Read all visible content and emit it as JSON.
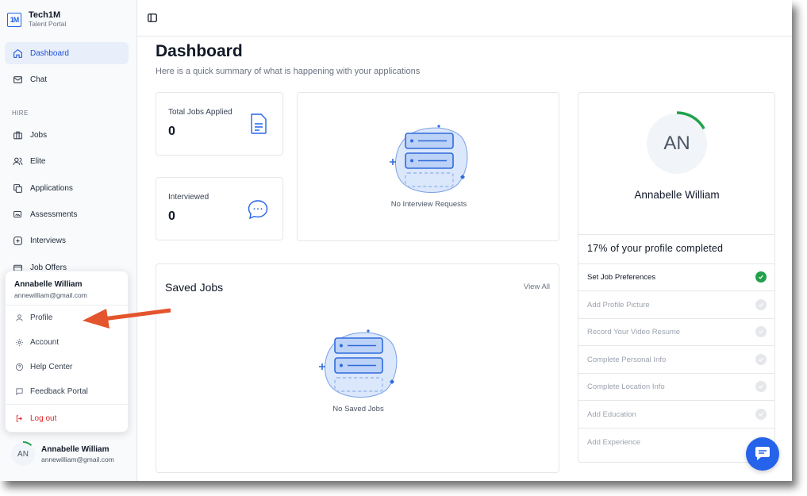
{
  "brand": {
    "name": "Tech1M",
    "subtitle": "Talent Portal",
    "logo_text": "1M"
  },
  "nav": {
    "dashboard": "Dashboard",
    "chat": "Chat",
    "section_hire": "HIRE",
    "jobs": "Jobs",
    "elite": "Elite",
    "applications": "Applications",
    "assessments": "Assessments",
    "interviews": "Interviews",
    "job_offers": "Job Offers"
  },
  "user_menu": {
    "name": "Annabelle William",
    "email": "annewilliam@gmail.com",
    "items": [
      "Profile",
      "Account",
      "Help Center",
      "Feedback Portal"
    ],
    "logout": "Log out"
  },
  "footer_user": {
    "initials": "AN",
    "name": "Annabelle William",
    "email": "annewilliam@gmail.com"
  },
  "page": {
    "title": "Dashboard",
    "subtitle": "Here is a quick summary of what is happening with your applications"
  },
  "stats": {
    "total_jobs_label": "Total Jobs Applied",
    "total_jobs_value": "0",
    "interviewed_label": "Interviewed",
    "interviewed_value": "0"
  },
  "interview_requests": {
    "empty_text": "No Interview Requests"
  },
  "saved_jobs": {
    "title": "Saved Jobs",
    "view_all": "View All",
    "empty_text": "No Saved Jobs"
  },
  "profile": {
    "initials": "AN",
    "name": "Annabelle William",
    "completion_fraction": 0.17,
    "completion_text": "17% of your profile completed",
    "tasks": [
      {
        "label": "Set Job Preferences",
        "done": true
      },
      {
        "label": "Add Profile Picture",
        "done": false
      },
      {
        "label": "Record Your Video Resume",
        "done": false
      },
      {
        "label": "Complete Personal Info",
        "done": false
      },
      {
        "label": "Complete Location Info",
        "done": false
      },
      {
        "label": "Add Education",
        "done": false
      },
      {
        "label": "Add Experience",
        "done": false
      }
    ]
  },
  "colors": {
    "accent": "#2563eb",
    "success": "#22a04b",
    "danger": "#dc2626",
    "arrow": "#e4542d"
  }
}
